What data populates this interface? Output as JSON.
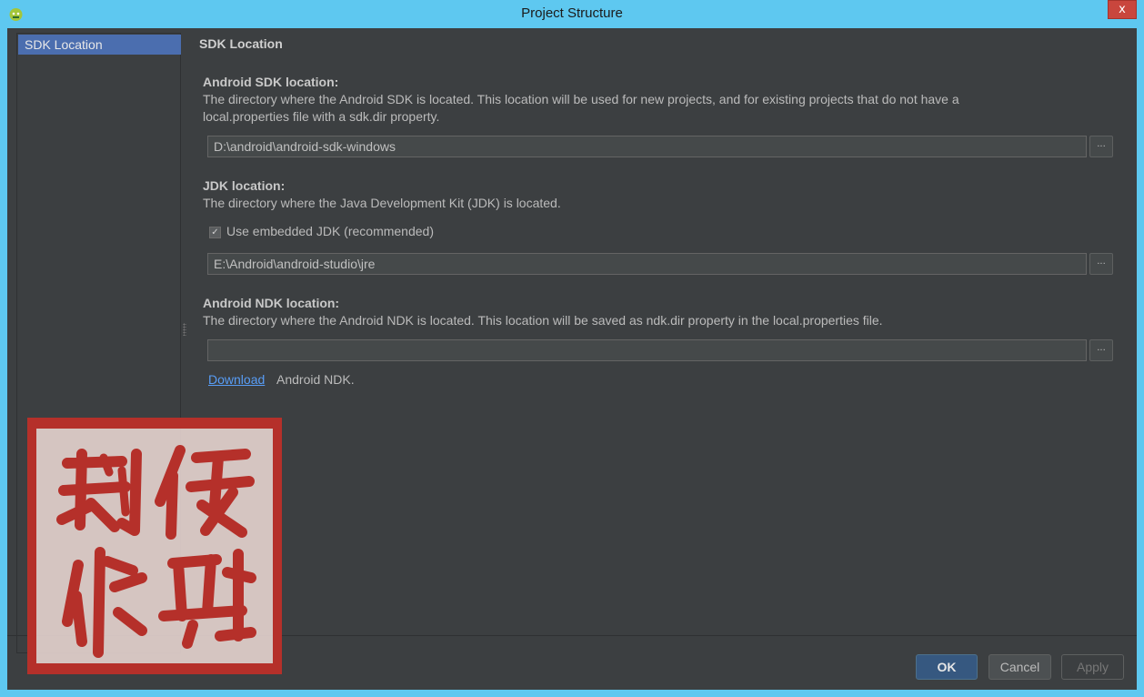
{
  "window": {
    "title": "Project Structure",
    "close_glyph": "x"
  },
  "sidebar": {
    "items": [
      {
        "label": "SDK Location",
        "selected": true
      }
    ]
  },
  "panel": {
    "title": "SDK Location",
    "android_sdk": {
      "label": "Android SDK location:",
      "description_line1": "The directory where the Android SDK is located. This location will be used for new projects, and for existing projects that do not have a",
      "description_line2": "local.properties file with a sdk.dir property.",
      "value": "D:\\android\\android-sdk-windows"
    },
    "jdk": {
      "label": "JDK location:",
      "description": "The directory where the Java Development Kit (JDK) is located.",
      "use_embedded_label": "Use embedded JDK (recommended)",
      "use_embedded_checked": true,
      "value": "E:\\Android\\android-studio\\jre"
    },
    "ndk": {
      "label": "Android NDK location:",
      "description": "The directory where the Android NDK is located. This location will be saved as ndk.dir property in the local.properties file.",
      "value": "",
      "download_link": "Download",
      "download_suffix": "Android NDK."
    },
    "browse_label": "..."
  },
  "buttons": {
    "ok": "OK",
    "cancel": "Cancel",
    "apply": "Apply"
  },
  "watermark": {
    "text": "刘依佳鹏"
  },
  "colors": {
    "titlebar": "#5ec8f0",
    "background": "#3c3f41",
    "selection": "#4b6eaf",
    "link": "#589df6",
    "seal": "#b5302a"
  }
}
